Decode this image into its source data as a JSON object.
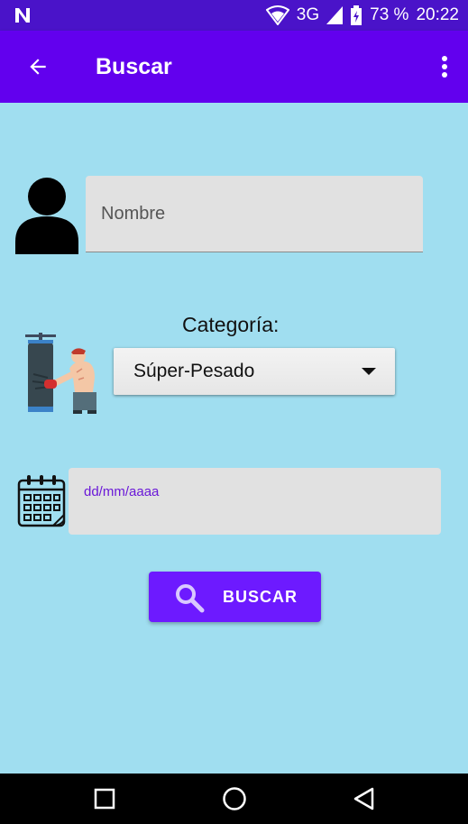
{
  "status_bar": {
    "network": "3G",
    "battery_percent": "73 %",
    "time": "20:22",
    "icons": [
      "notification-n-icon",
      "wifi-icon",
      "signal-icon",
      "battery-icon"
    ]
  },
  "app_bar": {
    "title": "Buscar",
    "back_icon": "arrow-back-icon",
    "menu_icon": "more-vert-icon"
  },
  "form": {
    "name_placeholder": "Nombre",
    "name_value": "",
    "category_label": "Categoría:",
    "category_selected": "Súper-Pesado",
    "date_hint": "dd/mm/aaaa",
    "search_button_label": "BUSCAR"
  },
  "nav_bar": {
    "icons": [
      "recent-apps-icon",
      "home-icon",
      "back-icon"
    ]
  },
  "colors": {
    "status_bar": "#4a13c9",
    "app_bar": "#6200ee",
    "background": "#a0def0",
    "field_bg": "#e1e1e1",
    "accent": "#6d1aff",
    "hint": "#6a18d8"
  }
}
